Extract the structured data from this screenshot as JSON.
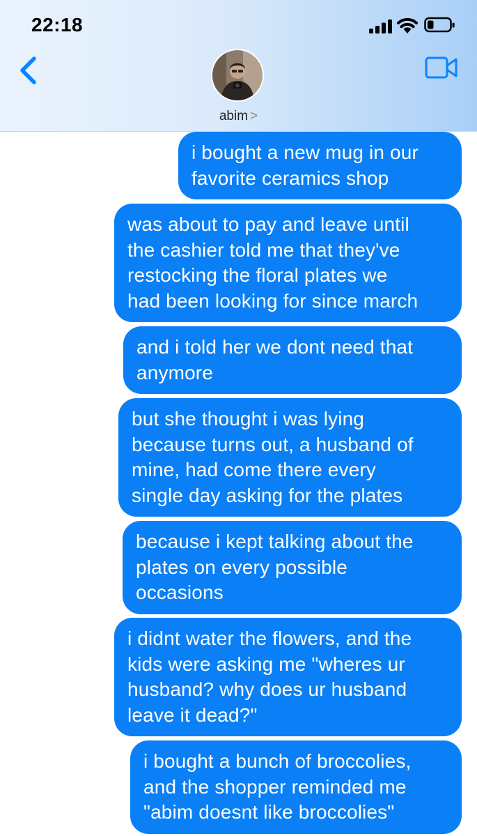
{
  "status_bar": {
    "time": "22:18"
  },
  "header": {
    "contact_name": "abim",
    "chevron": ">",
    "icons": {
      "back": "chevron-left-icon",
      "video": "video-camera-icon",
      "avatar": "contact-avatar"
    }
  },
  "colors": {
    "bubble": "#0a7ff6",
    "accent": "#0a84ff",
    "header_gradient": [
      "#eaf3fd",
      "#a9cff7"
    ]
  },
  "messages": [
    {
      "text": "i bought a new mug in our\nfavorite ceramics shop"
    },
    {
      "text": "was about to pay and leave until\nthe cashier told me that they've\nrestocking the floral plates we\nhad been looking for since march"
    },
    {
      "text": "and i told her we dont need that\nanymore"
    },
    {
      "text": "but she thought i was lying\nbecause turns out, a husband of\nmine, had come there every\nsingle day asking for the plates"
    },
    {
      "text": "because i kept talking about the\nplates on every possible\noccasions"
    },
    {
      "text": "i didnt water the flowers, and the\nkids were asking me \"wheres ur\nhusband? why does ur husband\nleave it dead?\""
    },
    {
      "text": "i bought a bunch of broccolies,\nand the shopper reminded me\n\"abim doesnt like broccolies\""
    }
  ]
}
